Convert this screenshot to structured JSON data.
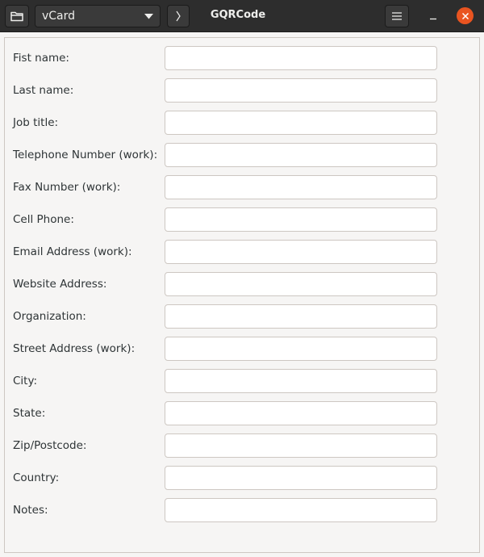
{
  "window": {
    "title": "GQRCode"
  },
  "header": {
    "open_icon": "folder-open-icon",
    "mode_selector": {
      "selected": "vCard",
      "icon": "chevron-down-icon"
    },
    "next_icon": "chevron-right-icon",
    "menu_icon": "hamburger-menu-icon",
    "minimize_icon": "minimize-icon",
    "close_icon": "close-icon",
    "close_color": "#e95420"
  },
  "form": {
    "fields": [
      {
        "label": "Fist name:",
        "value": ""
      },
      {
        "label": "Last name:",
        "value": ""
      },
      {
        "label": "Job title:",
        "value": ""
      },
      {
        "label": "Telephone Number (work):",
        "value": ""
      },
      {
        "label": "Fax Number (work):",
        "value": ""
      },
      {
        "label": "Cell Phone:",
        "value": ""
      },
      {
        "label": "Email Address (work):",
        "value": ""
      },
      {
        "label": "Website Address:",
        "value": ""
      },
      {
        "label": "Organization:",
        "value": ""
      },
      {
        "label": "Street Address (work):",
        "value": ""
      },
      {
        "label": "City:",
        "value": ""
      },
      {
        "label": "State:",
        "value": ""
      },
      {
        "label": "Zip/Postcode:",
        "value": ""
      },
      {
        "label": "Country:",
        "value": ""
      },
      {
        "label": "Notes:",
        "value": ""
      }
    ]
  }
}
